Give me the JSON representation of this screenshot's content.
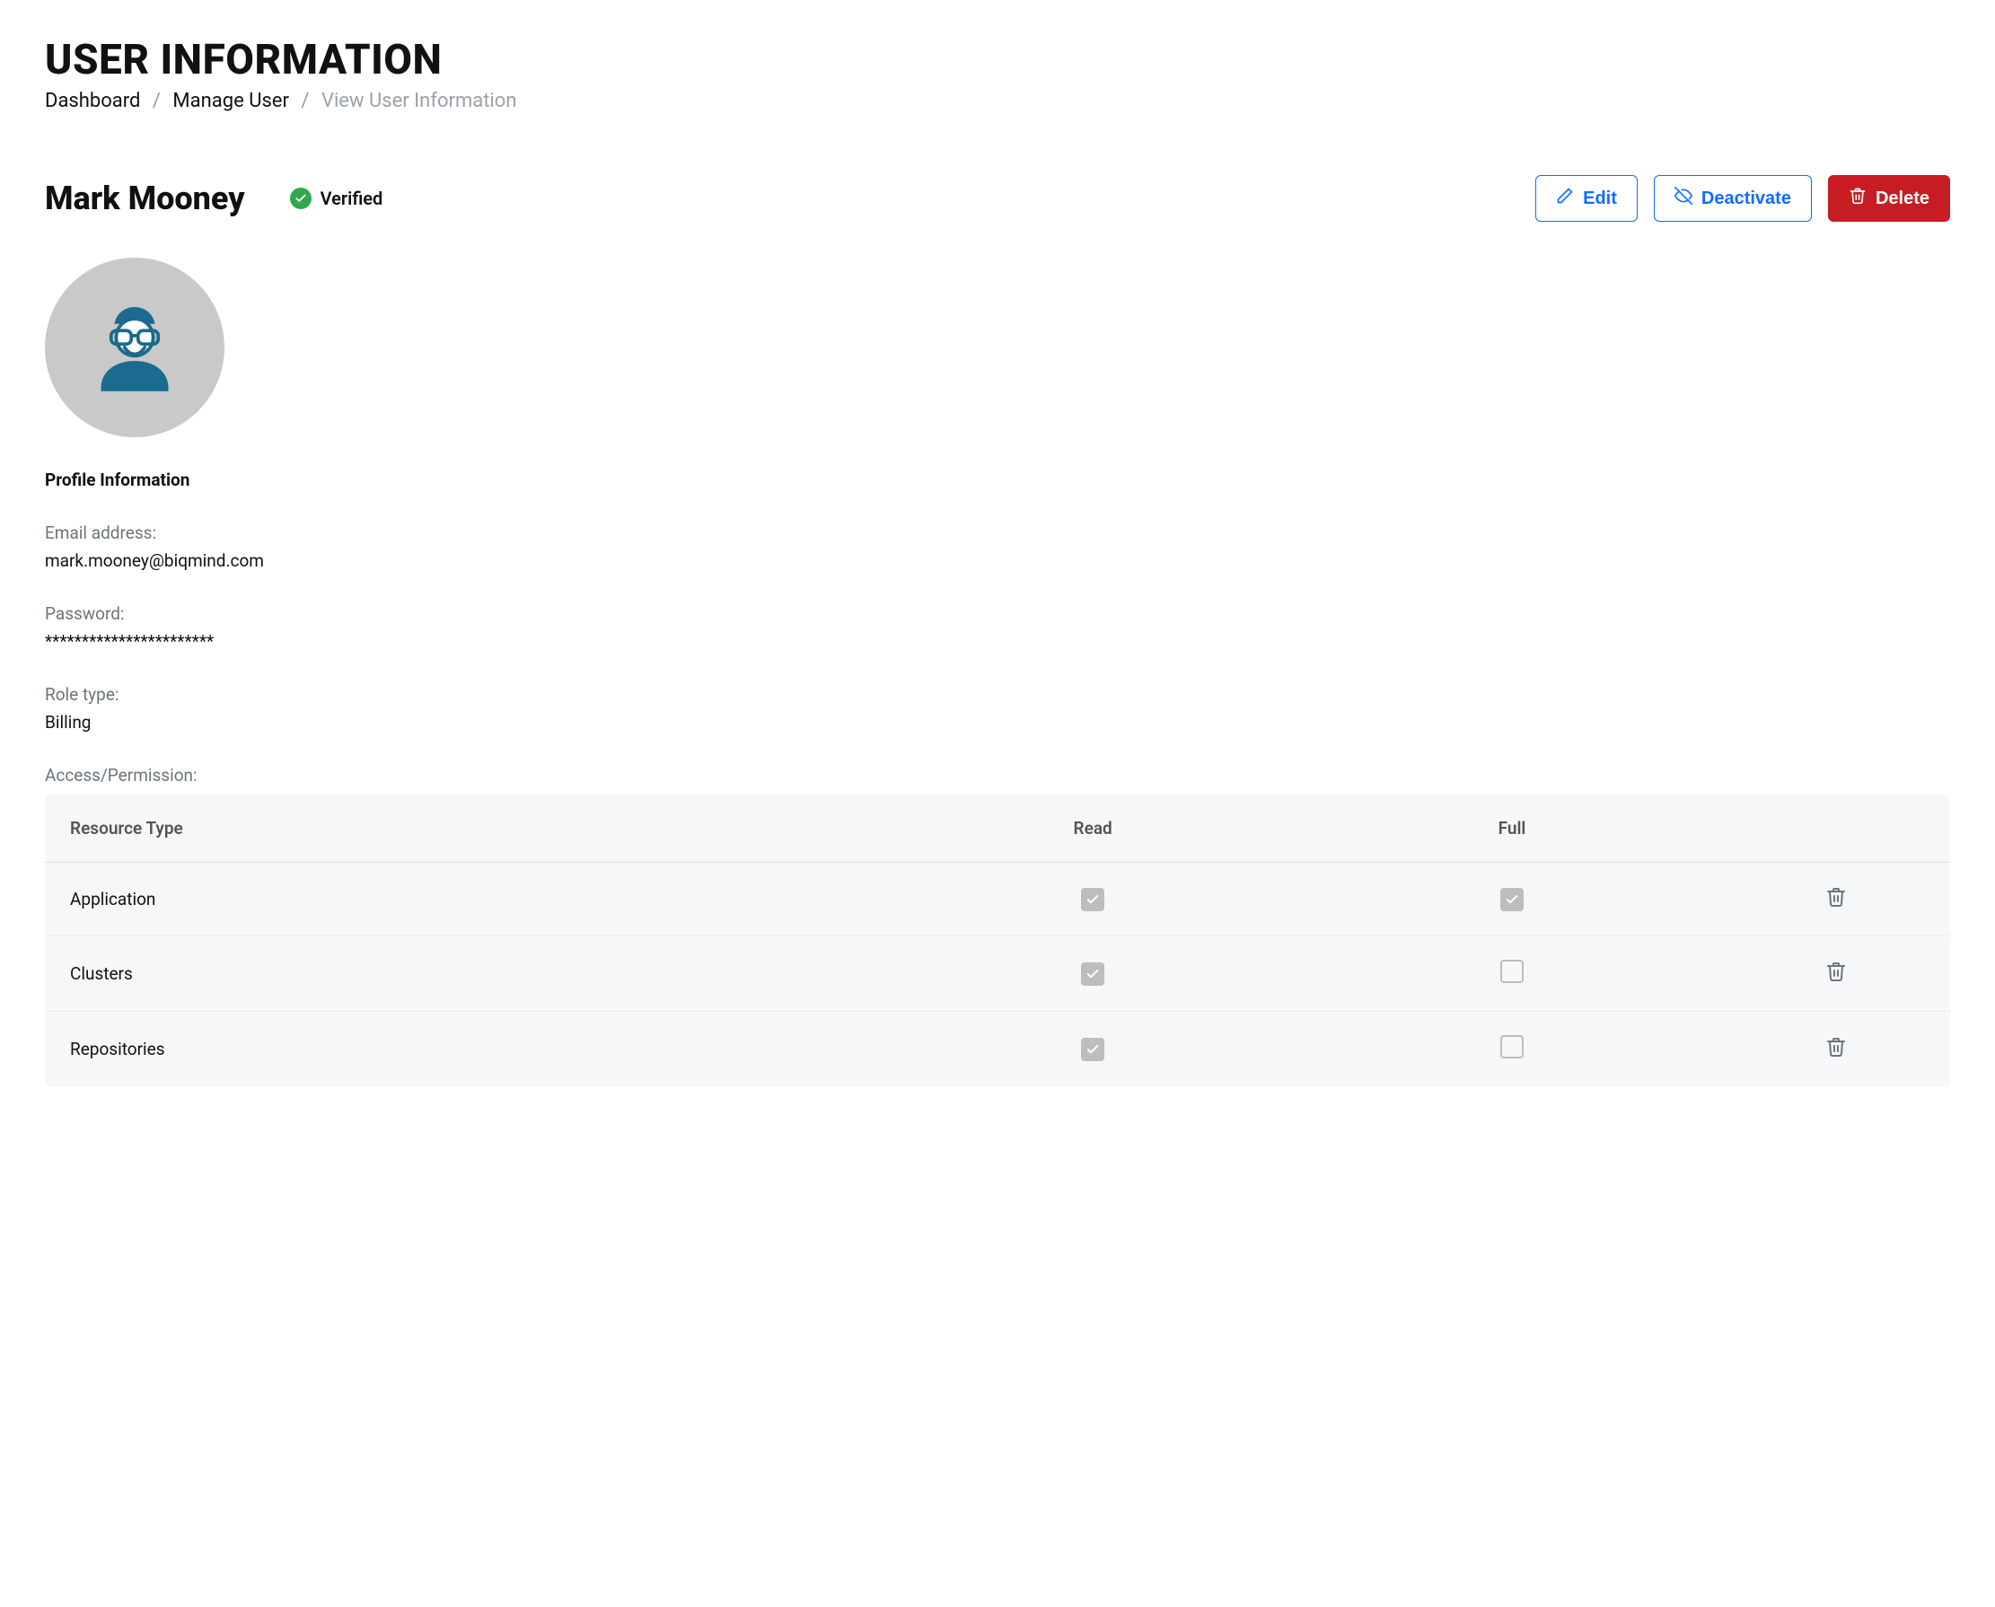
{
  "page": {
    "title": "USER INFORMATION"
  },
  "breadcrumb": {
    "items": [
      "Dashboard",
      "Manage User",
      "View User Information"
    ]
  },
  "user": {
    "name": "Mark Mooney",
    "verified_label": "Verified"
  },
  "actions": {
    "edit": "Edit",
    "deactivate": "Deactivate",
    "delete": "Delete"
  },
  "profile": {
    "section_title": "Profile Information",
    "email_label": "Email address:",
    "email_value": "mark.mooney@biqmind.com",
    "password_label": "Password:",
    "password_value": "***********************",
    "role_label": "Role type:",
    "role_value": "Billing",
    "access_label": "Access/Permission:"
  },
  "permissions": {
    "headers": {
      "resource": "Resource Type",
      "read": "Read",
      "full": "Full"
    },
    "rows": [
      {
        "resource": "Application",
        "read": true,
        "full": true
      },
      {
        "resource": "Clusters",
        "read": true,
        "full": false
      },
      {
        "resource": "Repositories",
        "read": true,
        "full": false
      }
    ]
  }
}
